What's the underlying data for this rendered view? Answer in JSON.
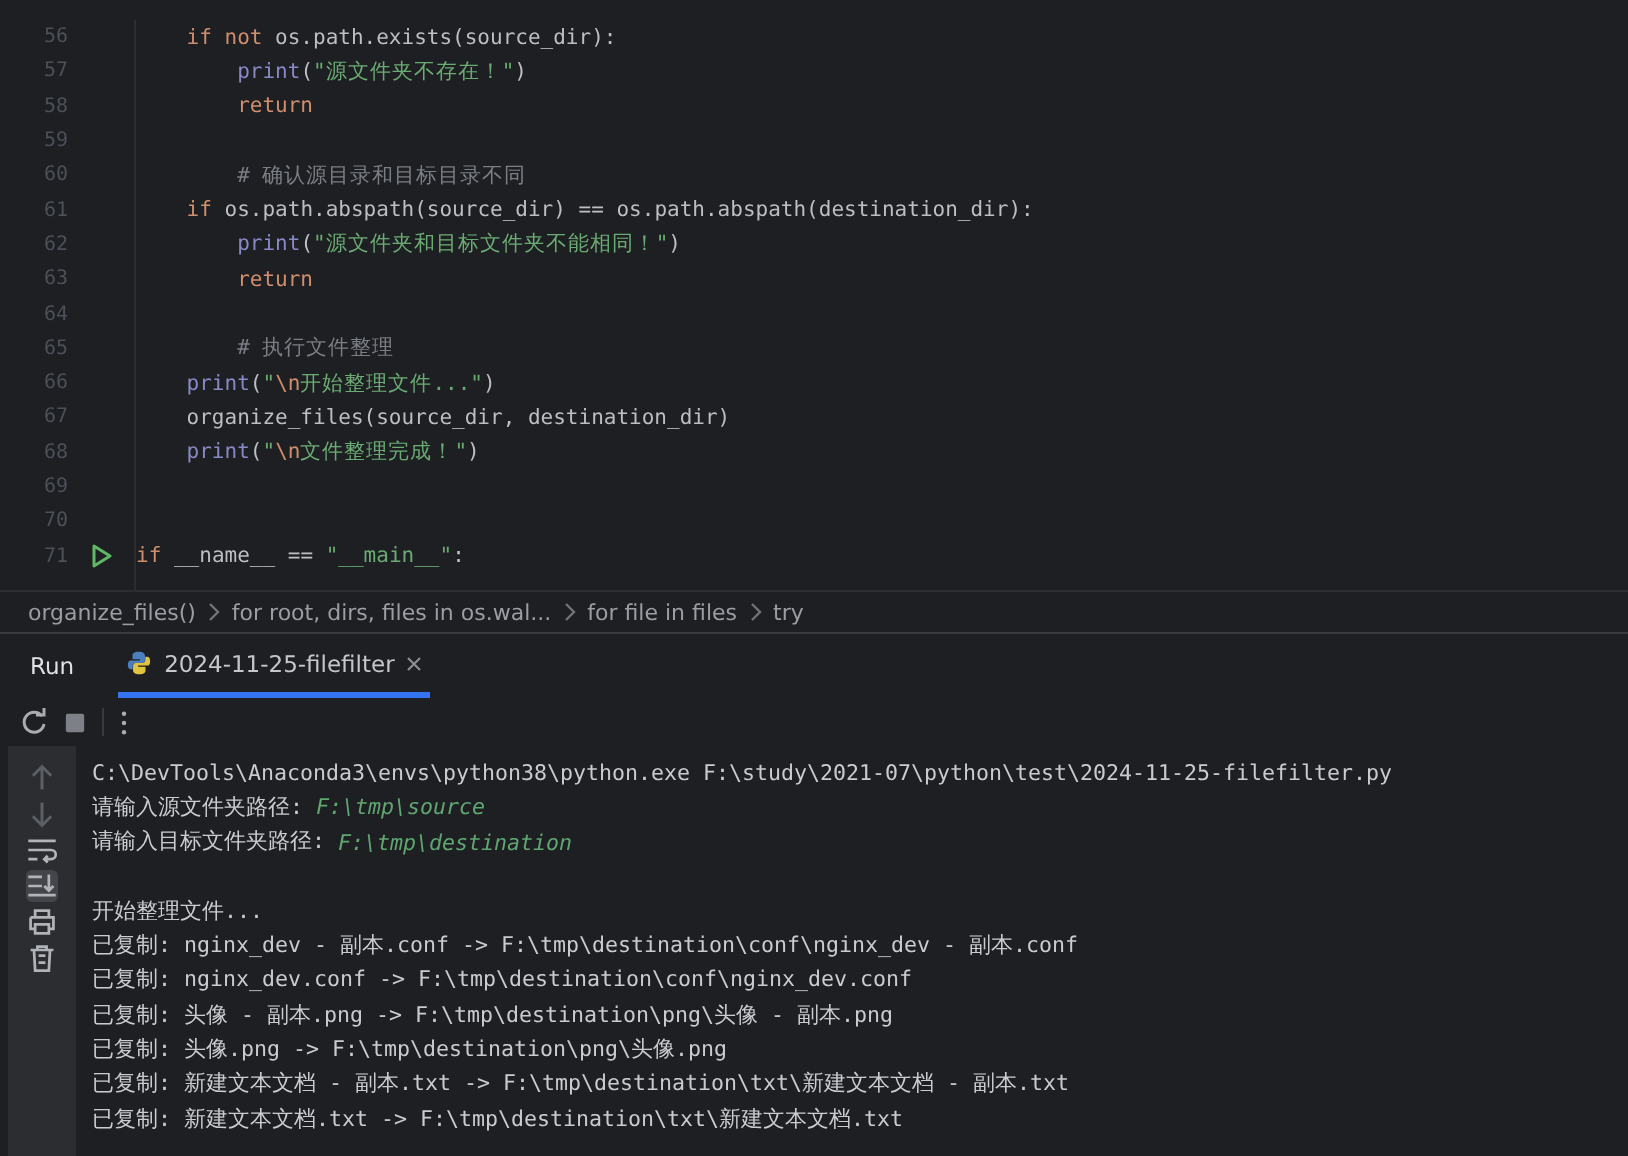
{
  "editor": {
    "lines": [
      {
        "number": "56",
        "tokens": [
          {
            "kind": "kw",
            "text": "    if not"
          },
          {
            "kind": "plain",
            "text": " os.path.exists(source_dir):"
          }
        ]
      },
      {
        "number": "57",
        "tokens": [
          {
            "kind": "builtin",
            "text": "        print"
          },
          {
            "kind": "plain",
            "text": "("
          },
          {
            "kind": "str",
            "text": "\"源文件夹不存在！\""
          },
          {
            "kind": "plain",
            "text": ")"
          }
        ]
      },
      {
        "number": "58",
        "tokens": [
          {
            "kind": "kw",
            "text": "        return"
          }
        ]
      },
      {
        "number": "59"
      },
      {
        "number": "60",
        "tokens": [
          {
            "kind": "comment",
            "text": "        # 确认源目录和目标目录不同"
          }
        ]
      },
      {
        "number": "61",
        "tokens": [
          {
            "kind": "kw",
            "text": "    if"
          },
          {
            "kind": "plain",
            "text": " os.path.abspath(source_dir) == os.path.abspath(destination_dir):"
          }
        ]
      },
      {
        "number": "62",
        "tokens": [
          {
            "kind": "builtin",
            "text": "        print"
          },
          {
            "kind": "plain",
            "text": "("
          },
          {
            "kind": "str",
            "text": "\"源文件夹和目标文件夹不能相同！\""
          },
          {
            "kind": "plain",
            "text": ")"
          }
        ]
      },
      {
        "number": "63",
        "tokens": [
          {
            "kind": "kw",
            "text": "        return"
          }
        ]
      },
      {
        "number": "64"
      },
      {
        "number": "65",
        "tokens": [
          {
            "kind": "comment",
            "text": "        # 执行文件整理"
          }
        ]
      },
      {
        "number": "66",
        "tokens": [
          {
            "kind": "builtin",
            "text": "    print"
          },
          {
            "kind": "plain",
            "text": "("
          },
          {
            "kind": "str",
            "text": "\""
          },
          {
            "kind": "escape",
            "text": "\\n"
          },
          {
            "kind": "str",
            "text": "开始整理文件...\""
          },
          {
            "kind": "plain",
            "text": ")"
          }
        ]
      },
      {
        "number": "67",
        "tokens": [
          {
            "kind": "plain",
            "text": "    organize_files(source_dir, destination_dir)"
          }
        ]
      },
      {
        "number": "68",
        "tokens": [
          {
            "kind": "builtin",
            "text": "    print"
          },
          {
            "kind": "plain",
            "text": "("
          },
          {
            "kind": "str",
            "text": "\""
          },
          {
            "kind": "escape",
            "text": "\\n"
          },
          {
            "kind": "str",
            "text": "文件整理完成！\""
          },
          {
            "kind": "plain",
            "text": ")"
          }
        ]
      },
      {
        "number": "69"
      },
      {
        "number": "70"
      },
      {
        "number": "71",
        "run_marker": true,
        "tokens": [
          {
            "kind": "kw",
            "text": "if"
          },
          {
            "kind": "plain",
            "text": " __name__ == "
          },
          {
            "kind": "str",
            "text": "\"__main__\""
          },
          {
            "kind": "plain",
            "text": ":"
          }
        ]
      }
    ]
  },
  "breadcrumbs": [
    "organize_files()",
    "for root, dirs, files in os.wal...",
    "for file in files",
    "try"
  ],
  "run_panel": {
    "title": "Run",
    "tabs": [
      {
        "label": "2024-11-25-filefilter",
        "selected": true
      }
    ],
    "console": [
      {
        "kind": "text",
        "segments": [
          {
            "kind": "out",
            "text": "C:\\DevTools\\Anaconda3\\envs\\python38\\python.exe F:\\study\\2021-07\\python\\test\\2024-11-25-filefilter.py"
          }
        ]
      },
      {
        "kind": "text",
        "segments": [
          {
            "kind": "out",
            "text": "请输入源文件夹路径: "
          },
          {
            "kind": "input",
            "text": "F:\\tmp\\source"
          }
        ]
      },
      {
        "kind": "text",
        "segments": [
          {
            "kind": "out",
            "text": "请输入目标文件夹路径: "
          },
          {
            "kind": "input",
            "text": "F:\\tmp\\destination"
          }
        ]
      },
      {
        "kind": "blank"
      },
      {
        "kind": "text",
        "segments": [
          {
            "kind": "out",
            "text": "开始整理文件..."
          }
        ]
      },
      {
        "kind": "text",
        "segments": [
          {
            "kind": "out",
            "text": "已复制: nginx_dev - 副本.conf -> F:\\tmp\\destination\\conf\\nginx_dev - 副本.conf"
          }
        ]
      },
      {
        "kind": "text",
        "segments": [
          {
            "kind": "out",
            "text": "已复制: nginx_dev.conf -> F:\\tmp\\destination\\conf\\nginx_dev.conf"
          }
        ]
      },
      {
        "kind": "text",
        "segments": [
          {
            "kind": "out",
            "text": "已复制: 头像 - 副本.png -> F:\\tmp\\destination\\png\\头像 - 副本.png"
          }
        ]
      },
      {
        "kind": "text",
        "segments": [
          {
            "kind": "out",
            "text": "已复制: 头像.png -> F:\\tmp\\destination\\png\\头像.png"
          }
        ]
      },
      {
        "kind": "text",
        "segments": [
          {
            "kind": "out",
            "text": "已复制: 新建文本文档 - 副本.txt -> F:\\tmp\\destination\\txt\\新建文本文档 - 副本.txt"
          }
        ]
      },
      {
        "kind": "text",
        "segments": [
          {
            "kind": "out",
            "text": "已复制: 新建文本文档.txt -> F:\\tmp\\destination\\txt\\新建文本文档.txt"
          }
        ]
      }
    ],
    "side_tools": [
      {
        "kind": "up",
        "on": false
      },
      {
        "kind": "down",
        "on": false
      },
      {
        "kind": "wrap",
        "on": false
      },
      {
        "kind": "scroll-end",
        "on": true
      },
      {
        "kind": "print",
        "on": false
      },
      {
        "kind": "trash",
        "on": false
      }
    ]
  }
}
